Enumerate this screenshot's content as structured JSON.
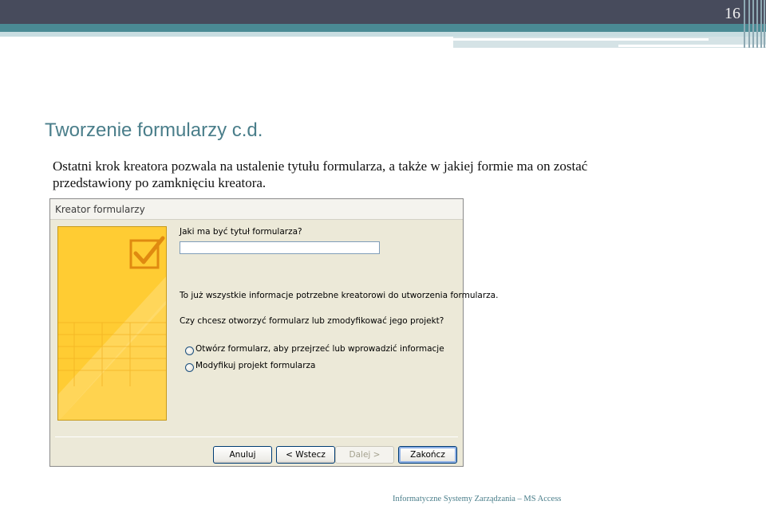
{
  "slide": {
    "number": "16",
    "title": "Tworzenie formularzy c.d.",
    "body": "Ostatni krok kreatora pozwala na ustalenie tytułu formularza, a także w jakiej formie ma on zostać przedstawiony po zamknięciu kreatora.",
    "footer": "Informatyczne Systemy Zarządzania – MS Access"
  },
  "dialog": {
    "title": "Kreator formularzy",
    "question_title": "Jaki ma być tytuł formularza?",
    "title_value": "",
    "info_text": "To już wszystkie informacje potrzebne kreatorowi do utworzenia formularza.",
    "question_open": "Czy chcesz otworzyć formularz lub zmodyfikować jego projekt?",
    "options": [
      {
        "label": "Otwórz formularz, aby przejrzeć lub wprowadzić informacje",
        "selected": false
      },
      {
        "label": "Modyfikuj projekt formularza",
        "selected": false
      }
    ],
    "buttons": {
      "cancel": "Anuluj",
      "back": "< Wstecz",
      "next": "Dalej >",
      "finish": "Zakończ"
    }
  },
  "colors": {
    "accent": "#4a7e8a",
    "header_dark": "#474b5c",
    "panel_yellow": "#ffcc33"
  },
  "icons": {
    "wizard_art": "checkbox-check-icon"
  }
}
